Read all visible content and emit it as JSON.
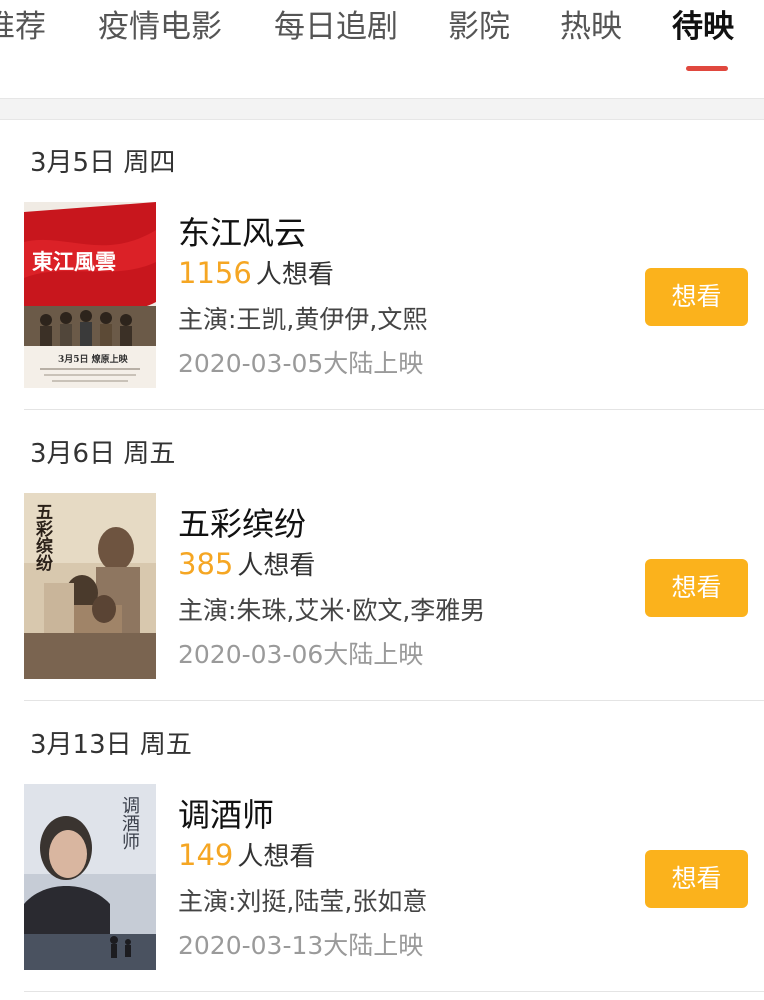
{
  "tabs": [
    {
      "label": "推荐"
    },
    {
      "label": "疫情电影"
    },
    {
      "label": "每日追剧"
    },
    {
      "label": "影院"
    },
    {
      "label": "热映"
    },
    {
      "label": "待映"
    }
  ],
  "active_tab": "待映",
  "colors": {
    "accent_indicator": "#e0483e",
    "want_count": "#f5a623",
    "want_button": "#fbb21c"
  },
  "sections": [
    {
      "date": "3月5日 周四",
      "movie": {
        "title": "东江风云",
        "want_count": "1156",
        "want_suffix": "人想看",
        "cast": "主演:王凯,黄伊伊,文熙",
        "release": "2020-03-05大陆上映",
        "button": "想看",
        "poster_title": "東江風雲",
        "poster_date": "3月5日 燎原上映"
      }
    },
    {
      "date": "3月6日 周五",
      "movie": {
        "title": "五彩缤纷",
        "want_count": "385",
        "want_suffix": "人想看",
        "cast": "主演:朱珠,艾米·欧文,李雅男",
        "release": "2020-03-06大陆上映",
        "button": "想看",
        "poster_title": "五彩缤纷"
      }
    },
    {
      "date": "3月13日 周五",
      "movie": {
        "title": "调酒师",
        "want_count": "149",
        "want_suffix": "人想看",
        "cast": "主演:刘挺,陆莹,张如意",
        "release": "2020-03-13大陆上映",
        "button": "想看",
        "poster_title": "调酒师"
      }
    }
  ]
}
